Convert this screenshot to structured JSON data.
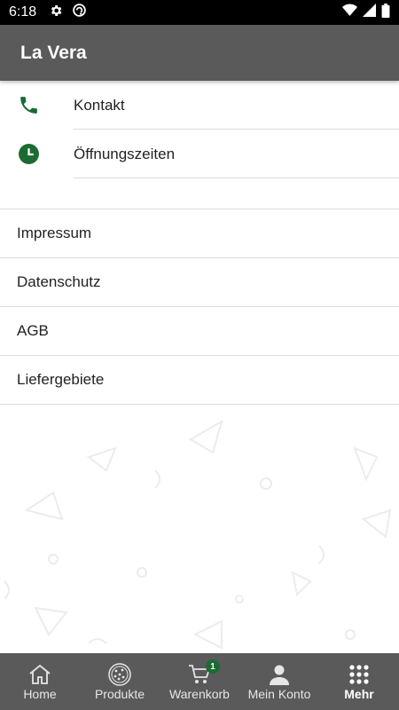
{
  "status_bar": {
    "time": "6:18",
    "icons": [
      "gear-icon",
      "sync-icon",
      "wifi-icon",
      "cell-signal-icon",
      "battery-icon"
    ]
  },
  "app_bar": {
    "title": "La Vera"
  },
  "contact_section": {
    "items": [
      {
        "label": "Kontakt",
        "icon": "phone-icon"
      },
      {
        "label": "Öffnungszeiten",
        "icon": "clock-icon"
      }
    ]
  },
  "links_section": {
    "items": [
      {
        "label": "Impressum"
      },
      {
        "label": "Datenschutz"
      },
      {
        "label": "AGB"
      },
      {
        "label": "Liefergebiete"
      }
    ]
  },
  "bottom_nav": {
    "items": [
      {
        "label": "Home",
        "icon": "home-icon"
      },
      {
        "label": "Produkte",
        "icon": "pizza-icon"
      },
      {
        "label": "Warenkorb",
        "icon": "cart-icon",
        "badge": "1"
      },
      {
        "label": "Mein Konto",
        "icon": "account-icon"
      },
      {
        "label": "Mehr",
        "icon": "more-grid-icon",
        "active": true
      }
    ]
  },
  "colors": {
    "accent_green": "#1b6b32",
    "app_bar_bg": "#5a5a5a",
    "divider": "#dcdcdc"
  }
}
